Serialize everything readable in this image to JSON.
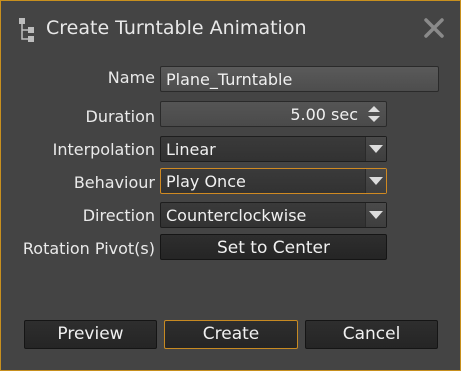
{
  "window": {
    "title": "Create Turntable Animation",
    "app_icon": "tree-hierarchy-icon",
    "close_icon": "close-icon",
    "accent_color": "#c8901e",
    "background_color": "#444444"
  },
  "form": {
    "name": {
      "label": "Name",
      "value": "Plane_Turntable"
    },
    "duration": {
      "label": "Duration",
      "value": "5.00 sec"
    },
    "interpolation": {
      "label": "Interpolation",
      "value": "Linear"
    },
    "behaviour": {
      "label": "Behaviour",
      "value": "Play Once"
    },
    "direction": {
      "label": "Direction",
      "value": "Counterclockwise"
    },
    "rotation_pivot": {
      "label": "Rotation Pivot(s)",
      "button_label": "Set to Center"
    }
  },
  "footer": {
    "preview_label": "Preview",
    "create_label": "Create",
    "cancel_label": "Cancel"
  }
}
